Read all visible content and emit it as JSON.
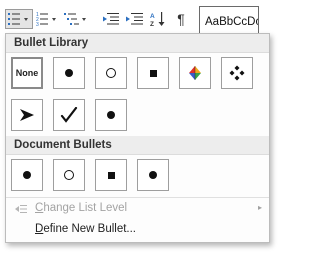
{
  "ribbon": {
    "style_preview": "AaBbCcDc",
    "buttons": [
      {
        "name": "bullets-button",
        "icon": "bullets-icon",
        "active": true
      },
      {
        "name": "numbering-button",
        "icon": "numbering-icon"
      },
      {
        "name": "multilevel-list-button",
        "icon": "multilevel-list-icon"
      },
      {
        "name": "decrease-indent-button",
        "icon": "decrease-indent-icon"
      },
      {
        "name": "increase-indent-button",
        "icon": "increase-indent-icon"
      },
      {
        "name": "sort-button",
        "icon": "sort-icon"
      },
      {
        "name": "show-formatting-marks-button",
        "icon": "pilcrow-icon"
      }
    ]
  },
  "bullet_library": {
    "title": "Bullet Library",
    "none_label": "None",
    "items": [
      "none",
      "filled-circle",
      "hollow-circle",
      "filled-square",
      "color-star",
      "four-diamonds",
      "arrowhead",
      "checkmark",
      "filled-circle"
    ]
  },
  "document_bullets": {
    "title": "Document Bullets",
    "items": [
      "filled-circle",
      "hollow-circle",
      "filled-square",
      "filled-circle"
    ]
  },
  "menu": {
    "change_list_level": {
      "accel": "C",
      "rest": "hange List Level",
      "enabled": false
    },
    "define_new_bullet": {
      "accel": "D",
      "rest": "efine New Bullet...",
      "enabled": true
    }
  },
  "colors": {
    "header_bg": "#ededed",
    "cell_border": "#9e9e9e",
    "disabled_text": "#a3a3a3"
  }
}
